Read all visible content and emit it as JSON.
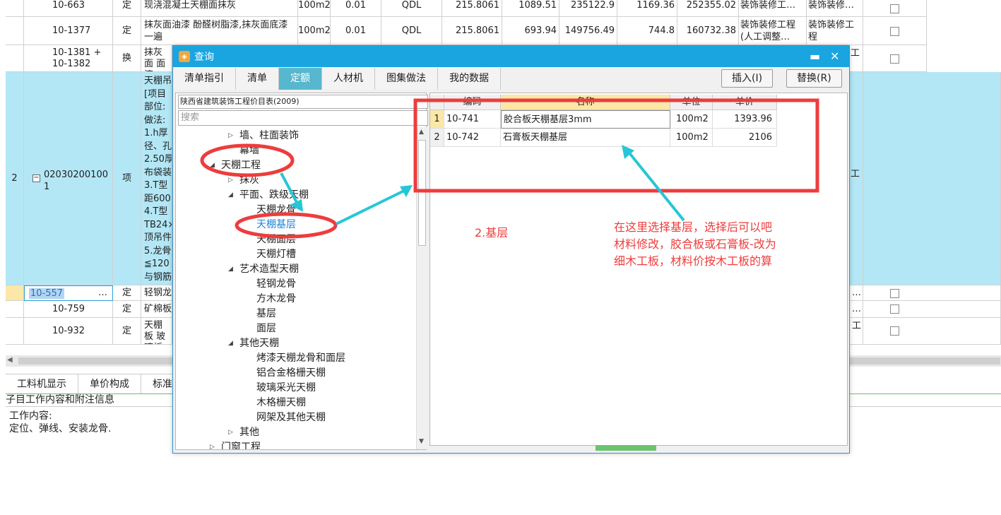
{
  "background_table": {
    "rows": [
      {
        "code": "10-663",
        "type": "定",
        "name": "现浇混凝土天棚面抹灰",
        "unit": "100m2",
        "qty": "0.01",
        "base": "QDL",
        "v1": "215.8061",
        "v2": "1089.51",
        "v3": "235122.9",
        "v4": "1169.36",
        "v5": "252355.02",
        "cat1": "装饰装修工…",
        "cat2": "装饰装修…"
      },
      {
        "code": "10-1377",
        "type": "定",
        "name": "抹灰面油漆 酚醛树脂漆,抹灰面底漆一遍",
        "unit": "100m2",
        "qty": "0.01",
        "base": "QDL",
        "v1": "215.8061",
        "v2": "693.94",
        "v3": "149756.49",
        "v4": "744.8",
        "v5": "160732.38",
        "cat1": "装饰装修工程(人工调整…",
        "cat2": "装饰装修工程"
      },
      {
        "code": "10-1381 + 10-1382",
        "type": "换",
        "name": "抹灰面 面漆一",
        "cat_tail": "工"
      },
      {
        "index": "2",
        "code": "020302001001",
        "type": "项",
        "name_lines": [
          "天棚吊",
          "[项目",
          "部位:",
          "做法:",
          "1.h厚",
          "径、孔",
          "2.50厚",
          "布袋装",
          "3.T型",
          "距600",
          "4.T型",
          "TB24×",
          "顶吊件",
          "5.龙骨",
          "≦120",
          "与钢筋"
        ],
        "cat_tail": "工"
      },
      {
        "code": "10-557",
        "type": "定",
        "name": "轻钢龙",
        "dots": "…",
        "cat_tail": "…"
      },
      {
        "code": "10-759",
        "type": "定",
        "name": "矿棉板",
        "cat_tail": "…"
      },
      {
        "code": "10-932",
        "type": "定",
        "name": "天棚板 玻璃板",
        "cat_tail": "工"
      }
    ]
  },
  "bottom_panel": {
    "tabs": [
      "工料机显示",
      "单价构成",
      "标准"
    ],
    "section_title": "子目工作内容和附注信息",
    "work_label": "工作内容:",
    "work_text": "定位、弹线、安装龙骨."
  },
  "dialog": {
    "title": "查询",
    "tabs": [
      "清单指引",
      "清单",
      "定额",
      "人材机",
      "图集做法",
      "我的数据"
    ],
    "active_tab": "定额",
    "insert_button": "插入(I)",
    "replace_button": "替换(R)",
    "library": "陕西省建筑装饰工程价目表(2009)",
    "search_placeholder": "搜索",
    "tree": [
      {
        "label": "墙、柱面装饰",
        "level": 3,
        "arrow": "▷"
      },
      {
        "label": "幕墙",
        "level": 3,
        "arrow": ""
      },
      {
        "label": "天棚工程",
        "level": 2,
        "arrow": "◢"
      },
      {
        "label": "抹灰",
        "level": 3,
        "arrow": "▷"
      },
      {
        "label": "平面、跌级天棚",
        "level": 3,
        "arrow": "◢"
      },
      {
        "label": "天棚龙骨",
        "level": 4,
        "arrow": ""
      },
      {
        "label": "天棚基层",
        "level": 4,
        "arrow": "",
        "selected": true
      },
      {
        "label": "天棚面层",
        "level": 4,
        "arrow": ""
      },
      {
        "label": "天棚灯槽",
        "level": 4,
        "arrow": ""
      },
      {
        "label": "艺术造型天棚",
        "level": 3,
        "arrow": "◢"
      },
      {
        "label": "轻钢龙骨",
        "level": 4,
        "arrow": ""
      },
      {
        "label": "方木龙骨",
        "level": 4,
        "arrow": ""
      },
      {
        "label": "基层",
        "level": 4,
        "arrow": ""
      },
      {
        "label": "面层",
        "level": 4,
        "arrow": ""
      },
      {
        "label": "其他天棚",
        "level": 3,
        "arrow": "◢"
      },
      {
        "label": "烤漆天棚龙骨和面层",
        "level": 4,
        "arrow": ""
      },
      {
        "label": "铝合金格栅天棚",
        "level": 4,
        "arrow": ""
      },
      {
        "label": "玻璃采光天棚",
        "level": 4,
        "arrow": ""
      },
      {
        "label": "木格栅天棚",
        "level": 4,
        "arrow": ""
      },
      {
        "label": "网架及其他天棚",
        "level": 4,
        "arrow": ""
      },
      {
        "label": "其他",
        "level": 3,
        "arrow": "▷"
      },
      {
        "label": "门窗工程",
        "level": 2,
        "arrow": "▷"
      }
    ],
    "grid_headers": [
      "编码",
      "名称",
      "单位",
      "单价"
    ],
    "grid_rows": [
      {
        "idx": "1",
        "code": "10-741",
        "name": "胶合板天棚基层3mm",
        "unit": "100m2",
        "price": "1393.96"
      },
      {
        "idx": "2",
        "code": "10-742",
        "name": "石膏板天棚基层",
        "unit": "100m2",
        "price": "2106"
      }
    ]
  },
  "annotations": {
    "label_base": "2.基层",
    "note_lines": [
      "在这里选择基层，选择后可以吧",
      "材料修改，胶合板或石膏板-改为",
      "细木工板，材料价按木工板的算"
    ],
    "colors": {
      "red": "#ee3c3c",
      "cyan": "#27c6d6"
    }
  },
  "colors": {
    "title_bar": "#1aa5e0",
    "active_tab": "#57b7cf",
    "selected_row": "#b3e7f6",
    "highlight_header": "#fbe7a7"
  }
}
